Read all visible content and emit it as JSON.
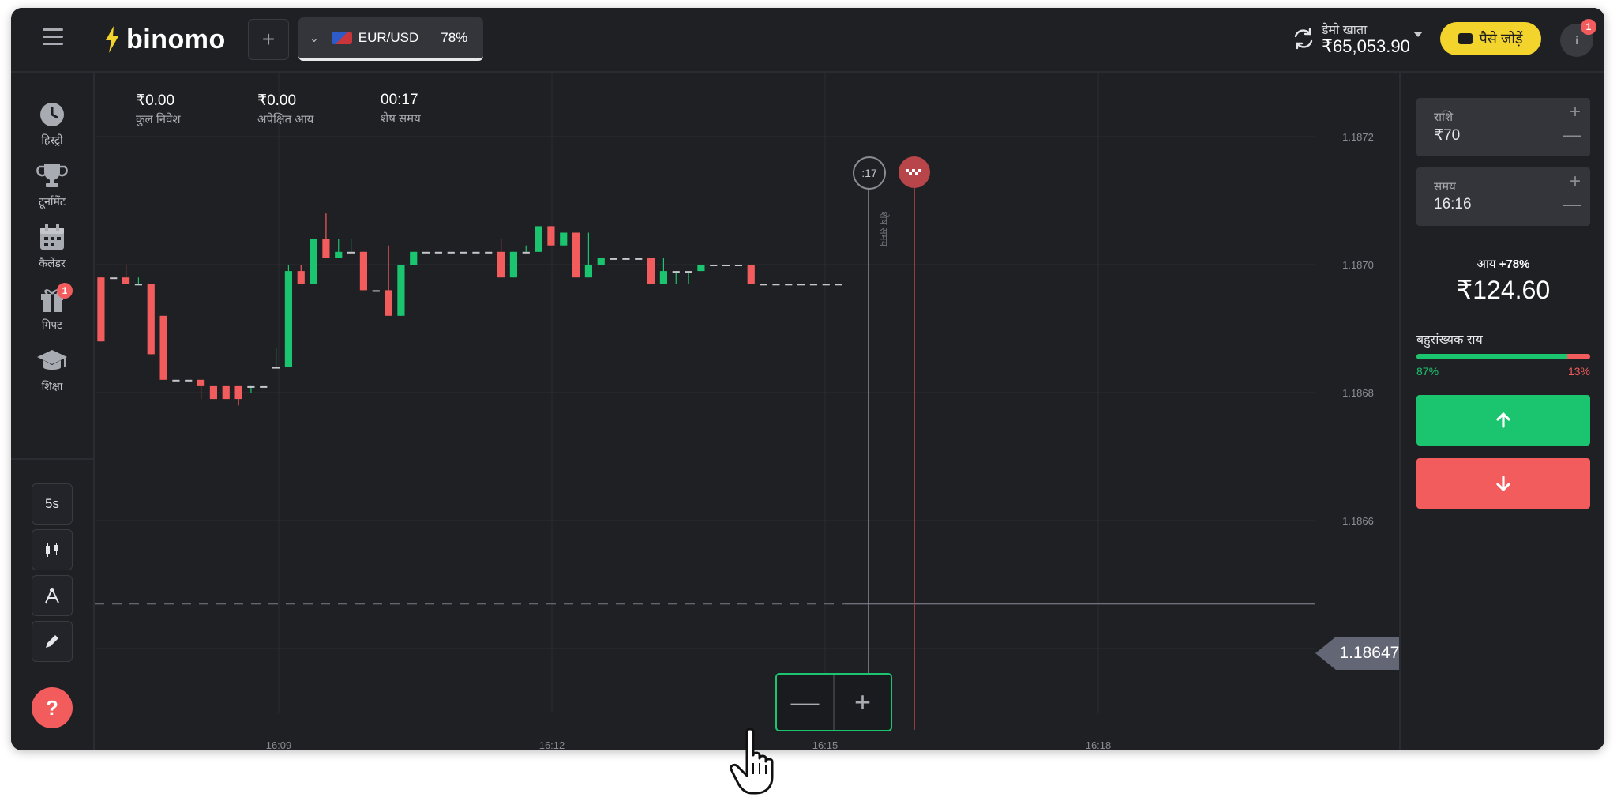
{
  "header": {
    "logo_text": "binomo",
    "asset": {
      "name": "EUR/USD",
      "payout": "78%"
    },
    "account": {
      "label": "डेमो खाता",
      "balance": "₹65,053.90"
    },
    "deposit_label": "पैसे जोड़ें",
    "avatar_initial": "i",
    "notification_count": "1"
  },
  "sidebar": {
    "items": [
      {
        "label": "हिस्ट्री",
        "icon": "history-icon"
      },
      {
        "label": "टूर्नामेंट",
        "icon": "trophy-icon"
      },
      {
        "label": "कैलेंडर",
        "icon": "calendar-icon"
      },
      {
        "label": "गिफ्ट",
        "icon": "gift-icon",
        "badge": "1"
      },
      {
        "label": "शिक्षा",
        "icon": "graduation-cap-icon"
      }
    ],
    "tools": {
      "interval": "5s",
      "chart_type_icon": "candles-icon",
      "indicators_icon": "indicator-icon",
      "draw_icon": "pencil-icon"
    },
    "help_label": "?"
  },
  "stats": [
    {
      "value": "₹0.00",
      "label": "कुल निवेश"
    },
    {
      "value": "₹0.00",
      "label": "अपेक्षित आय"
    },
    {
      "value": "00:17",
      "label": "शेष समय"
    }
  ],
  "chart_overlay": {
    "timer": ":17",
    "remaining_vertical": "शेष समय",
    "current_price": "1.186470"
  },
  "chart_data": {
    "type": "candlestick",
    "y_ticks": [
      "1.1872",
      "1.1870",
      "1.1868",
      "1.1866",
      "1.1864"
    ],
    "x_ticks": [
      "16:09",
      "16:12",
      "16:15",
      "16:18"
    ],
    "ylim": [
      1.1863,
      1.1873
    ],
    "current_price": 1.18647,
    "candles": [
      [
        1.18698,
        1.18698,
        1.18688,
        1.18688
      ],
      [
        1.18698,
        1.18698,
        1.18698,
        1.18698
      ],
      [
        1.18698,
        1.187,
        1.18697,
        1.18697
      ],
      [
        1.18697,
        1.18698,
        1.18697,
        1.18697
      ],
      [
        1.18697,
        1.18697,
        1.18686,
        1.18686
      ],
      [
        1.18692,
        1.18692,
        1.18682,
        1.18682
      ],
      [
        1.18682,
        1.18682,
        1.18682,
        1.18682
      ],
      [
        1.18682,
        1.18682,
        1.18682,
        1.18682
      ],
      [
        1.18682,
        1.18682,
        1.18679,
        1.18681
      ],
      [
        1.18681,
        1.18681,
        1.18679,
        1.18679
      ],
      [
        1.18681,
        1.18681,
        1.18679,
        1.18679
      ],
      [
        1.18681,
        1.18681,
        1.18678,
        1.18679
      ],
      [
        1.18681,
        1.18681,
        1.1868,
        1.18681
      ],
      [
        1.18681,
        1.18681,
        1.18681,
        1.18681
      ],
      [
        1.18684,
        1.18687,
        1.18684,
        1.18684
      ],
      [
        1.18684,
        1.187,
        1.18684,
        1.18699
      ],
      [
        1.18699,
        1.187,
        1.18697,
        1.18697
      ],
      [
        1.18697,
        1.18704,
        1.18697,
        1.18704
      ],
      [
        1.18704,
        1.18708,
        1.18701,
        1.18701
      ],
      [
        1.18701,
        1.18704,
        1.18701,
        1.18702
      ],
      [
        1.18702,
        1.18704,
        1.18702,
        1.18702
      ],
      [
        1.18702,
        1.18702,
        1.18696,
        1.18696
      ],
      [
        1.18696,
        1.18696,
        1.18696,
        1.18696
      ],
      [
        1.18696,
        1.18703,
        1.18692,
        1.18692
      ],
      [
        1.18692,
        1.187,
        1.18692,
        1.187
      ],
      [
        1.187,
        1.18702,
        1.187,
        1.18702
      ],
      [
        1.18702,
        1.18702,
        1.18702,
        1.18702
      ],
      [
        1.18702,
        1.18702,
        1.18702,
        1.18702
      ],
      [
        1.18702,
        1.18702,
        1.18702,
        1.18702
      ],
      [
        1.18702,
        1.18702,
        1.18702,
        1.18702
      ],
      [
        1.18702,
        1.18702,
        1.18702,
        1.18702
      ],
      [
        1.18702,
        1.18702,
        1.18702,
        1.18702
      ],
      [
        1.18702,
        1.18704,
        1.18698,
        1.18698
      ],
      [
        1.18698,
        1.18702,
        1.18698,
        1.18702
      ],
      [
        1.18702,
        1.18703,
        1.18702,
        1.18702
      ],
      [
        1.18702,
        1.18706,
        1.18702,
        1.18706
      ],
      [
        1.18706,
        1.18706,
        1.18703,
        1.18703
      ],
      [
        1.18703,
        1.18705,
        1.18703,
        1.18705
      ],
      [
        1.18705,
        1.18705,
        1.18698,
        1.18698
      ],
      [
        1.18698,
        1.18705,
        1.18698,
        1.187
      ],
      [
        1.187,
        1.18701,
        1.187,
        1.18701
      ],
      [
        1.18701,
        1.18701,
        1.18701,
        1.18701
      ],
      [
        1.18701,
        1.18701,
        1.18701,
        1.18701
      ],
      [
        1.18701,
        1.18701,
        1.18701,
        1.18701
      ],
      [
        1.18701,
        1.18701,
        1.18697,
        1.18697
      ],
      [
        1.18697,
        1.18701,
        1.18697,
        1.18699
      ],
      [
        1.18699,
        1.18699,
        1.18697,
        1.18699
      ],
      [
        1.18699,
        1.18699,
        1.18697,
        1.18699
      ],
      [
        1.18699,
        1.187,
        1.18699,
        1.187
      ],
      [
        1.187,
        1.187,
        1.187,
        1.187
      ],
      [
        1.187,
        1.187,
        1.187,
        1.187
      ],
      [
        1.187,
        1.187,
        1.187,
        1.187
      ],
      [
        1.187,
        1.187,
        1.18697,
        1.18697
      ],
      [
        1.18697,
        1.18697,
        1.18697,
        1.18697
      ],
      [
        1.18697,
        1.18697,
        1.18697,
        1.18697
      ],
      [
        1.18697,
        1.18697,
        1.18697,
        1.18697
      ],
      [
        1.18697,
        1.18697,
        1.18697,
        1.18697
      ],
      [
        1.18697,
        1.18697,
        1.18697,
        1.18697
      ],
      [
        1.18697,
        1.18697,
        1.18697,
        1.18697
      ],
      [
        1.18697,
        1.18697,
        1.18697,
        1.18697
      ]
    ]
  },
  "right_panel": {
    "amount": {
      "label": "राशि",
      "value": "₹70"
    },
    "time": {
      "label": "समय",
      "value": "16:16"
    },
    "income_label": "आय",
    "income_pct": "+78%",
    "income_value": "₹124.60",
    "majority_label": "बहुसंख्यक राय",
    "majority_up": "87%",
    "majority_down": "13%",
    "majority_up_fraction": 0.87
  },
  "colors": {
    "up": "#1bc46e",
    "down": "#f25c5c",
    "accent": "#f3d42c",
    "background": "#1f2024"
  }
}
